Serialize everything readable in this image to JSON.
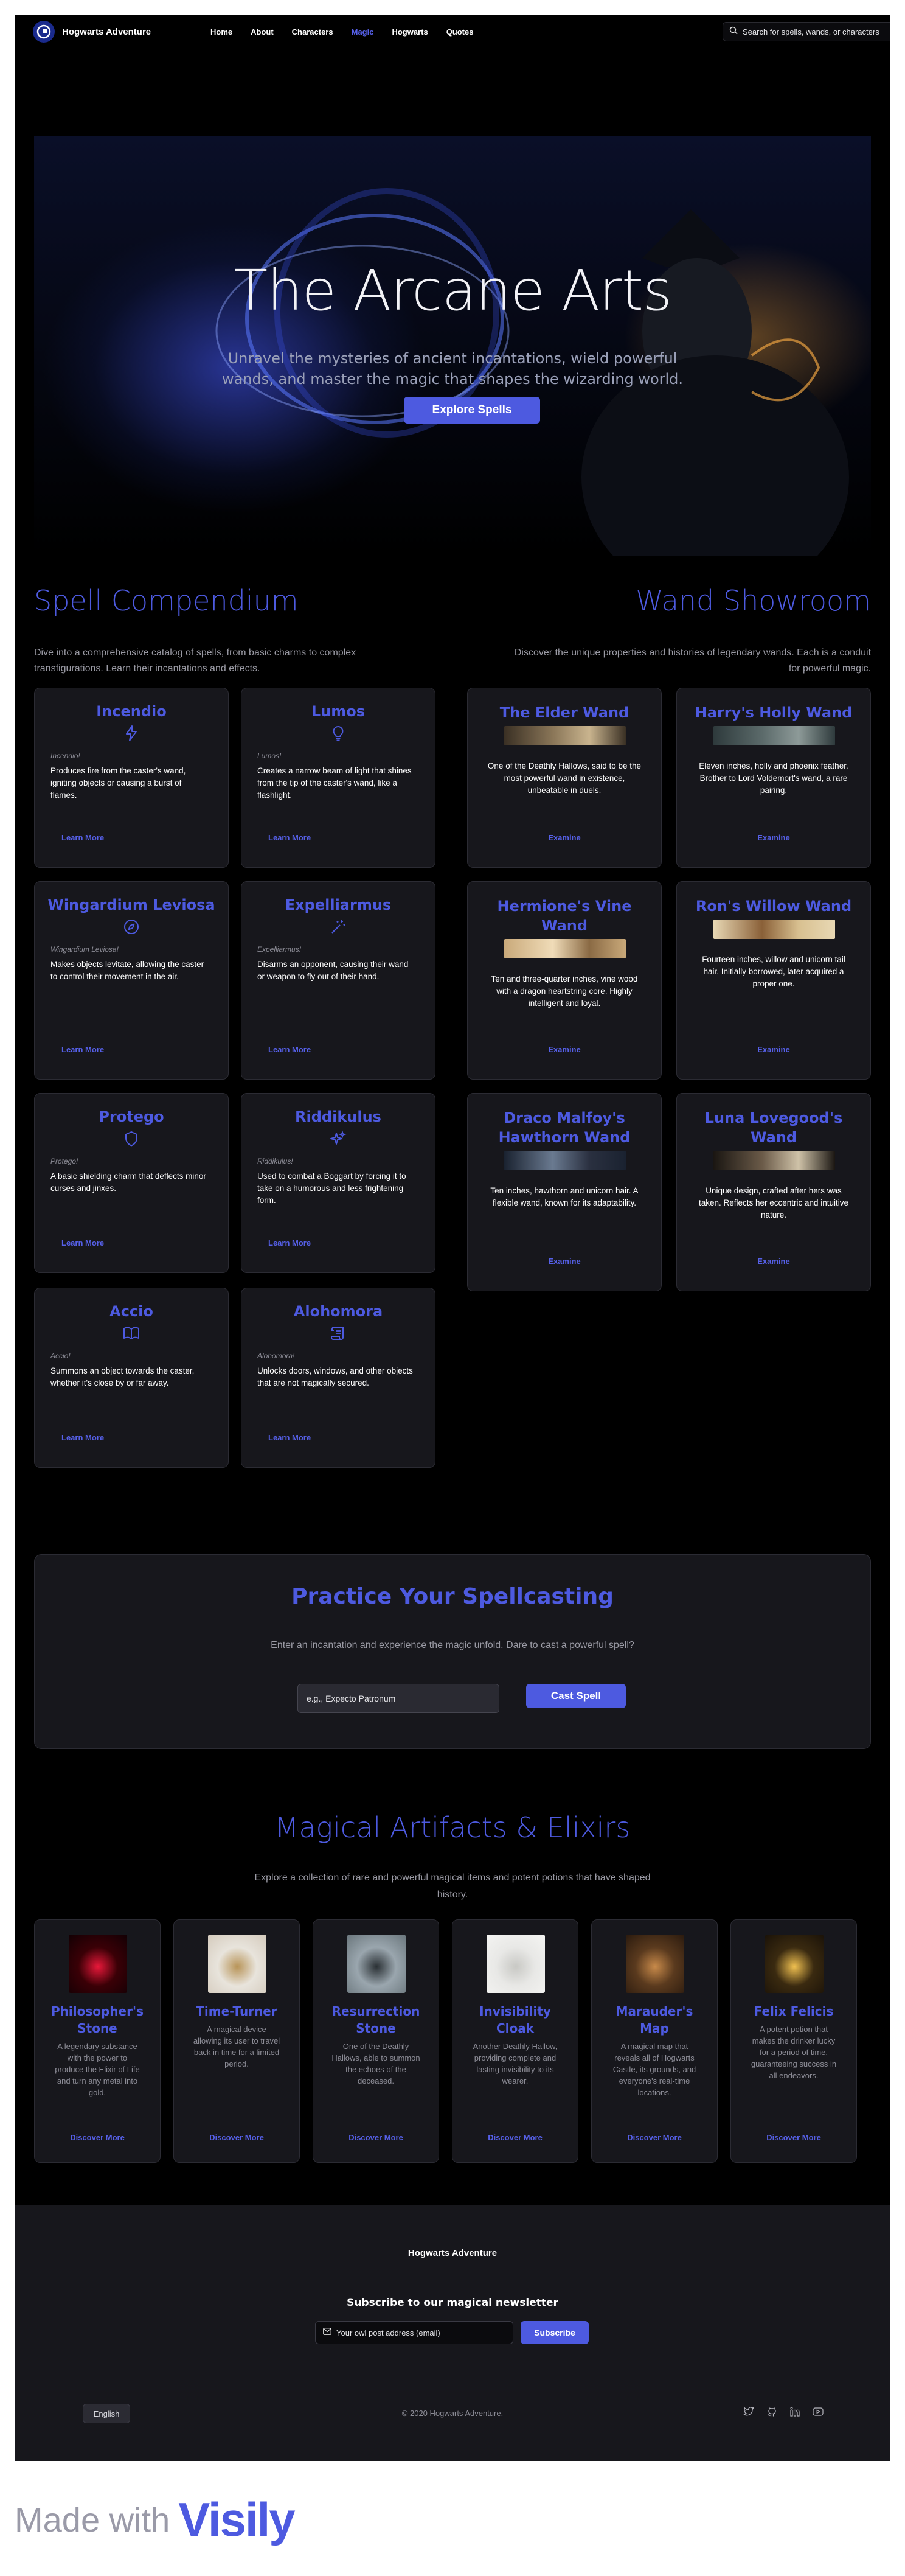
{
  "nav": {
    "brand": "Hogwarts Adventure",
    "links": [
      "Home",
      "About",
      "Characters",
      "Magic",
      "Hogwarts",
      "Quotes"
    ],
    "active": "Magic",
    "search_placeholder": "Search for spells, wands, or characters"
  },
  "hero": {
    "title": "The Arcane Arts",
    "subtitle_line1": "Unravel the mysteries of ancient incantations, wield powerful",
    "subtitle_line2": "wands, and master the magic that shapes the wizarding world.",
    "button": "Explore Spells"
  },
  "spells": {
    "title": "Spell Compendium",
    "desc_line1": "Dive into a comprehensive catalog of spells, from basic charms to complex",
    "desc_line2": "transfigurations. Learn their incantations and effects.",
    "items": [
      {
        "name": "Incendio",
        "incantation": "Incendio!",
        "icon": "lightning-icon",
        "desc": [
          "Produces fire from the caster's wand,",
          "igniting objects or causing a burst of",
          "flames."
        ],
        "link": "Learn More"
      },
      {
        "name": "Lumos",
        "incantation": "Lumos!",
        "icon": "lightbulb-icon",
        "desc": [
          "Creates a narrow beam of light that shines",
          "from the tip of the caster's wand, like a",
          "flashlight."
        ],
        "link": "Learn More"
      },
      {
        "name": "Wingardium Leviosa",
        "incantation": "Wingardium Leviosa!",
        "icon": "compass-icon",
        "desc": [
          "Makes objects levitate, allowing the caster",
          "to control their movement in the air."
        ],
        "link": "Learn More"
      },
      {
        "name": "Expelliarmus",
        "incantation": "Expelliarmus!",
        "icon": "magic-wand-icon",
        "desc": [
          "Disarms an opponent, causing their wand",
          "or weapon to fly out of their hand."
        ],
        "link": "Learn More"
      },
      {
        "name": "Protego",
        "incantation": "Protego!",
        "icon": "shield-icon",
        "desc": [
          "A basic shielding charm that deflects minor",
          "curses and jinxes."
        ],
        "link": "Learn More"
      },
      {
        "name": "Riddikulus",
        "incantation": "Riddikulus!",
        "icon": "sparkles-icon",
        "desc": [
          "Used to combat a Boggart by forcing it to",
          "take on a humorous and less frightening",
          "form."
        ],
        "link": "Learn More"
      },
      {
        "name": "Accio",
        "incantation": "Accio!",
        "icon": "open-book-icon",
        "desc": [
          "Summons an object towards the caster,",
          "whether it's close by or far away."
        ],
        "link": "Learn More"
      },
      {
        "name": "Alohomora",
        "incantation": "Alohomora!",
        "icon": "scroll-icon",
        "desc": [
          "Unlocks doors, windows, and other objects",
          "that are not magically secured."
        ],
        "link": "Learn More"
      }
    ]
  },
  "wands": {
    "title": "Wand Showroom",
    "desc_line1": "Discover the unique properties and histories of legendary wands. Each is a conduit",
    "desc_line2": "for powerful magic.",
    "items": [
      {
        "name": [
          "The Elder Wand"
        ],
        "desc": [
          "One of the Deathly Hallows, said to be the",
          "most powerful wand in existence,",
          "unbeatable in duels."
        ],
        "link": "Examine",
        "img_colors": [
          "#3a3024",
          "#8a7658",
          "#c9b48e"
        ]
      },
      {
        "name": [
          "Harry's Holly Wand"
        ],
        "desc": [
          "Eleven inches, holly and phoenix feather.",
          "Brother to Lord Voldemort's wand, a rare",
          "pairing."
        ],
        "link": "Examine",
        "img_colors": [
          "#2e3a3c",
          "#5b6a6a",
          "#8d9a98"
        ]
      },
      {
        "name": [
          "Hermione's Vine",
          "Wand"
        ],
        "desc": [
          "Ten and three-quarter inches, vine wood",
          "with a dragon heartstring core. Highly",
          "intelligent and loyal."
        ],
        "link": "Examine",
        "img_colors": [
          "#c9a97a",
          "#f0dcb8",
          "#8a6a44"
        ]
      },
      {
        "name": [
          "Ron's Willow Wand"
        ],
        "desc": [
          "Fourteen inches, willow and unicorn tail",
          "hair. Initially borrowed, later acquired a",
          "proper one."
        ],
        "link": "Examine",
        "img_colors": [
          "#e8d8b4",
          "#8a6038",
          "#d8c090"
        ]
      },
      {
        "name": [
          "Draco Malfoy's",
          "Hawthorn Wand"
        ],
        "desc": [
          "Ten inches, hawthorn and unicorn hair. A",
          "flexible wand, known for its adaptability."
        ],
        "link": "Examine",
        "img_colors": [
          "#1a2230",
          "#6a7a90",
          "#2a3040"
        ]
      },
      {
        "name": [
          "Luna Lovegood's",
          "Wand"
        ],
        "desc": [
          "Unique design, crafted after hers was",
          "taken. Reflects her eccentric and intuitive",
          "nature."
        ],
        "link": "Examine",
        "img_colors": [
          "#1a1612",
          "#6a5a48",
          "#cfc2a8"
        ]
      }
    ]
  },
  "practice": {
    "title": "Practice Your Spellcasting",
    "desc": "Enter an incantation and experience the magic unfold. Dare to cast a powerful spell?",
    "placeholder": "e.g., Expecto Patronum",
    "button": "Cast Spell"
  },
  "artifacts": {
    "title": "Magical Artifacts & Elixirs",
    "desc_line1": "Explore a collection of rare and powerful magical items and potent potions that have shaped",
    "desc_line2": "history.",
    "items": [
      {
        "name": [
          "Philosopher's",
          "Stone"
        ],
        "desc": [
          "A legendary substance",
          "with the power to",
          "produce the Elixir of Life",
          "and turn any metal into",
          "gold."
        ],
        "link": "Discover More",
        "img_colors": [
          "#3a0006",
          "#e8183a",
          "#120004"
        ]
      },
      {
        "name": [
          "Time-Turner"
        ],
        "desc": [
          "A magical device",
          "allowing its user to travel",
          "back in time for a limited",
          "period."
        ],
        "link": "Discover More",
        "img_colors": [
          "#e8e4dc",
          "#b89458",
          "#d4cabc"
        ]
      },
      {
        "name": [
          "Resurrection",
          "Stone"
        ],
        "desc": [
          "One of the Deathly",
          "Hallows, able to summon",
          "the echoes of the",
          "deceased."
        ],
        "link": "Discover More",
        "img_colors": [
          "#9aa6ae",
          "#2a3034",
          "#6a767c"
        ]
      },
      {
        "name": [
          "Invisibility",
          "Cloak"
        ],
        "desc": [
          "Another Deathly Hallow,",
          "providing complete and",
          "lasting invisibility to its",
          "wearer."
        ],
        "link": "Discover More",
        "img_colors": [
          "#e8e8e6",
          "#c8c8c4",
          "#f4f4f2"
        ]
      },
      {
        "name": [
          "Marauder's",
          "Map"
        ],
        "desc": [
          "A magical map that",
          "reveals all of Hogwarts",
          "Castle, its grounds, and",
          "everyone's real-time",
          "locations."
        ],
        "link": "Discover More",
        "img_colors": [
          "#5a3a1e",
          "#c88a4a",
          "#2a1a0e"
        ]
      },
      {
        "name": [
          "Felix Felicis"
        ],
        "desc": [
          "A potent potion that",
          "makes the drinker lucky",
          "for a period of time,",
          "guaranteeing success in",
          "all endeavors."
        ],
        "link": "Discover More",
        "img_colors": [
          "#3a2a10",
          "#f0c050",
          "#1a1208"
        ]
      }
    ]
  },
  "footer": {
    "brand": "Hogwarts Adventure",
    "subscribe_title": "Subscribe to our magical newsletter",
    "email_placeholder": "Your owl post address (email)",
    "subscribe_button": "Subscribe",
    "language": "English",
    "copyright": "© 2020 Hogwarts Adventure.",
    "socials": [
      "twitter-icon",
      "github-icon",
      "linkedin-icon",
      "youtube-icon"
    ]
  },
  "made_with": {
    "text": "Made with",
    "logo": "Visily"
  },
  "colors": {
    "accent": "#4d5ae0",
    "card": "#17171c",
    "background": "#000000"
  }
}
